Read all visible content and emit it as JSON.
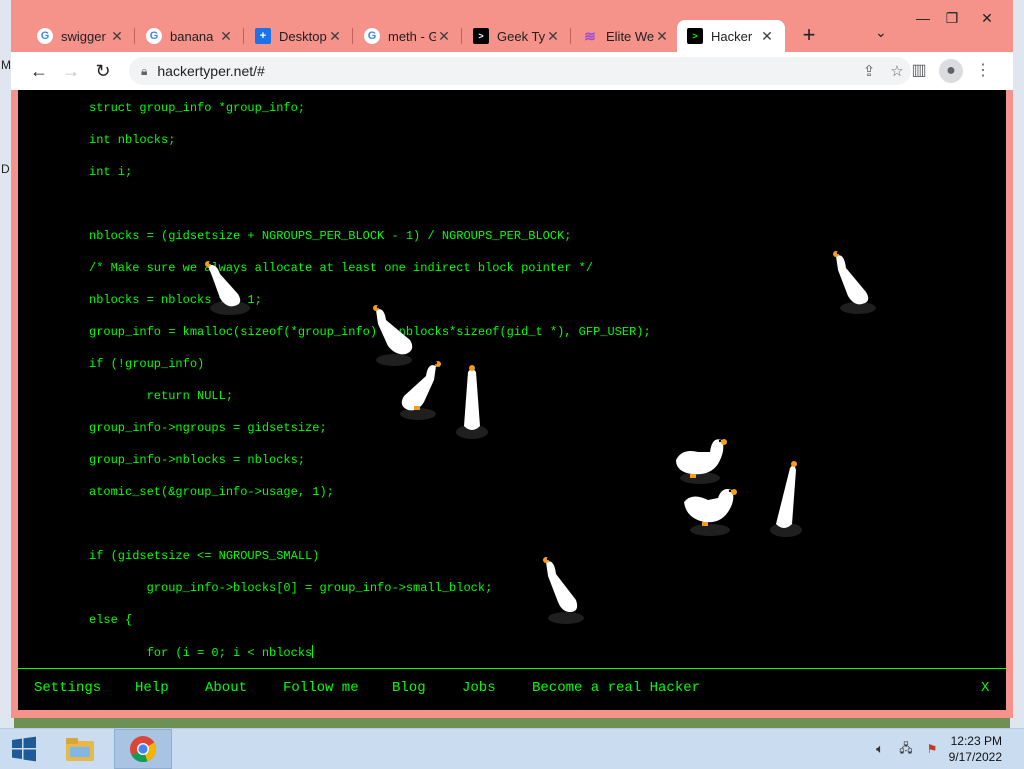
{
  "browser": {
    "tabs": [
      {
        "title": "swigger",
        "icon": "google-icon"
      },
      {
        "title": "banana",
        "icon": "google-icon"
      },
      {
        "title": "Desktop",
        "icon": "desktop-app-icon"
      },
      {
        "title": "meth - G",
        "icon": "google-icon"
      },
      {
        "title": "Geek Ty",
        "icon": "terminal-icon"
      },
      {
        "title": "Elite We",
        "icon": "elite-icon"
      },
      {
        "title": "Hacker",
        "icon": "terminal-icon",
        "active": true
      }
    ],
    "new_tab": "+",
    "url": "hackertyper.net/#"
  },
  "code_lines": [
    "struct group_info *group_info;",
    "int nblocks;",
    "int i;",
    "",
    "nblocks = (gidsetsize + NGROUPS_PER_BLOCK - 1) / NGROUPS_PER_BLOCK;",
    "/* Make sure we always allocate at least one indirect block pointer */",
    "nblocks = nblocks ? : 1;",
    "group_info = kmalloc(sizeof(*group_info) + nblocks*sizeof(gid_t *), GFP_USER);",
    "if (!group_info)",
    "        return NULL;",
    "group_info->ngroups = gidsetsize;",
    "group_info->nblocks = nblocks;",
    "atomic_set(&group_info->usage, 1);",
    "",
    "if (gidsetsize <= NGROUPS_SMALL)",
    "        group_info->blocks[0] = group_info->small_block;",
    "else {",
    "        for (i = 0; i < nblocks"
  ],
  "menu": {
    "settings": "Settings",
    "help": "Help",
    "about": "About",
    "follow": "Follow me",
    "blog": "Blog",
    "jobs": "Jobs",
    "real_hacker": "Become a real Hacker",
    "close": "X"
  },
  "taskbar": {
    "time": "12:23 PM",
    "date": "9/17/2022"
  },
  "colors": {
    "terminal_green": "#00ff00",
    "frame": "#f5928a"
  }
}
